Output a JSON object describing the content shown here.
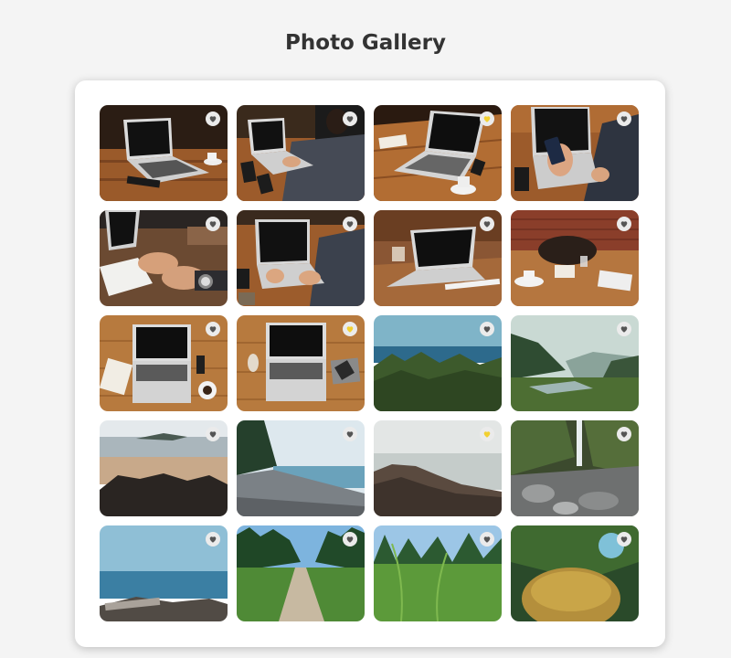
{
  "page": {
    "title": "Photo Gallery"
  },
  "colors": {
    "heart_default": "#555555",
    "heart_favorite": "#f2d031",
    "heart_bg": "#ebebeb"
  },
  "gallery": {
    "photos": [
      {
        "name": "laptop-desk-dark",
        "favorite": false
      },
      {
        "name": "man-typing-laptop",
        "favorite": false
      },
      {
        "name": "laptop-wooden-table-coffee",
        "favorite": true
      },
      {
        "name": "hands-phone-laptop",
        "favorite": false
      },
      {
        "name": "hands-writing-notebook",
        "favorite": false
      },
      {
        "name": "typing-laptop-phone",
        "favorite": false
      },
      {
        "name": "laptop-glass-table",
        "favorite": false
      },
      {
        "name": "bag-desk-brick-wall",
        "favorite": false
      },
      {
        "name": "laptop-notebook-coffee-top",
        "favorite": false
      },
      {
        "name": "laptop-phone-top",
        "favorite": true
      },
      {
        "name": "sea-forest",
        "favorite": false
      },
      {
        "name": "valley-river",
        "favorite": false
      },
      {
        "name": "rocky-beach",
        "favorite": false
      },
      {
        "name": "pebble-shore",
        "favorite": false
      },
      {
        "name": "rocks-calm-sea",
        "favorite": true
      },
      {
        "name": "waterfall-rocks",
        "favorite": false
      },
      {
        "name": "driftwood-coast",
        "favorite": false
      },
      {
        "name": "path-through-meadow",
        "favorite": false
      },
      {
        "name": "grass-closeup",
        "favorite": false
      },
      {
        "name": "mossy-rock-forest",
        "favorite": false
      }
    ]
  }
}
